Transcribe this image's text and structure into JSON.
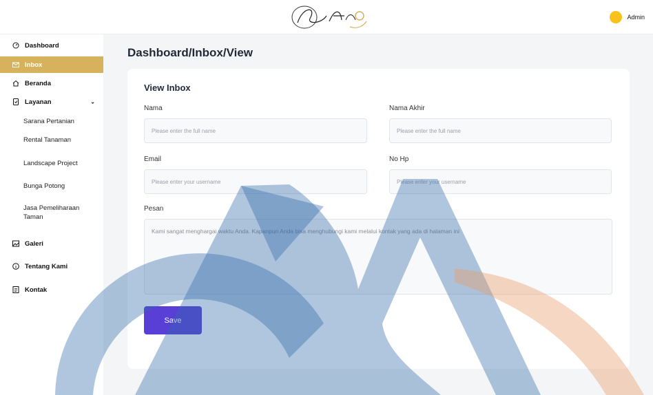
{
  "header": {
    "logo_text": "Sekar Asri",
    "user_name": "Admin",
    "avatar_color": "#f7c21a"
  },
  "sidebar": {
    "items": [
      {
        "label": "Dashboard",
        "icon": "dashboard-icon"
      },
      {
        "label": "Inbox",
        "icon": "mail-icon",
        "active": true
      },
      {
        "label": "Beranda",
        "icon": "home-icon"
      },
      {
        "label": "Layanan",
        "icon": "document-icon",
        "expanded": true
      },
      {
        "label": "Galeri",
        "icon": "gallery-icon"
      },
      {
        "label": "Tentang Kami",
        "icon": "info-icon"
      },
      {
        "label": "Kontak",
        "icon": "contact-icon"
      }
    ],
    "sub_items": [
      {
        "label": "Sarana Pertanian"
      },
      {
        "label": "Rental Tanaman"
      },
      {
        "label": "Landscape Project"
      },
      {
        "label": "Bunga Potong"
      },
      {
        "label": "Jasa Pemeliharaan Taman"
      }
    ],
    "accent_color": "#d6b25c"
  },
  "main": {
    "breadcrumb": "Dashboard/Inbox/View",
    "card_title": "View Inbox",
    "fields": {
      "nama": {
        "label": "Nama",
        "placeholder": "Please enter the full name"
      },
      "nama_akhir": {
        "label": "Nama Akhir",
        "placeholder": "Please enter the full name"
      },
      "email": {
        "label": "Email",
        "placeholder": "Please enter your username"
      },
      "no_hp": {
        "label": "No Hp",
        "placeholder": "Please enter your username"
      },
      "pesan": {
        "label": "Pesan",
        "value": "Kami sangat menghargai waktu Anda. Kapanpun Anda bisa menghubungi kami melalui kontak yang ada di halaman ini"
      }
    },
    "save_label": "Save",
    "button_color": "#5a3fd6"
  }
}
